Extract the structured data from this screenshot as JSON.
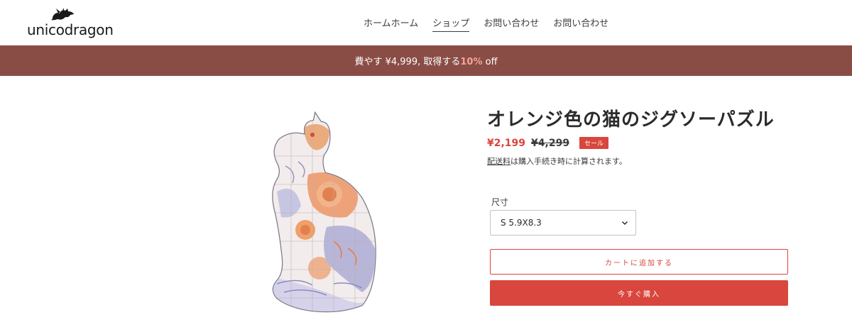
{
  "header": {
    "logo_text": "unicodragon",
    "nav": [
      {
        "label": "ホームホーム"
      },
      {
        "label": "ショップ"
      },
      {
        "label": "お問い合わせ"
      },
      {
        "label": "お問い合わせ"
      }
    ]
  },
  "announcement": {
    "text_before": "費やす ¥4,999, 取得する",
    "accent": "10%",
    "text_after": " off"
  },
  "product": {
    "title": "オレンジ色の猫のジグソーパズル",
    "sale_price": "¥2,199",
    "compare_price": "¥4,299",
    "badge": "セール",
    "shipping_link": "配送料",
    "shipping_rest": "は購入手続き時に計算されます。",
    "size_label": "尺寸",
    "size_value": "S 5.9X8.3",
    "add_to_cart": "カートに追加する",
    "buy_now": "今すぐ購入"
  },
  "colors": {
    "announcement_bg": "#8a4d46",
    "accent": "#d9463d"
  }
}
